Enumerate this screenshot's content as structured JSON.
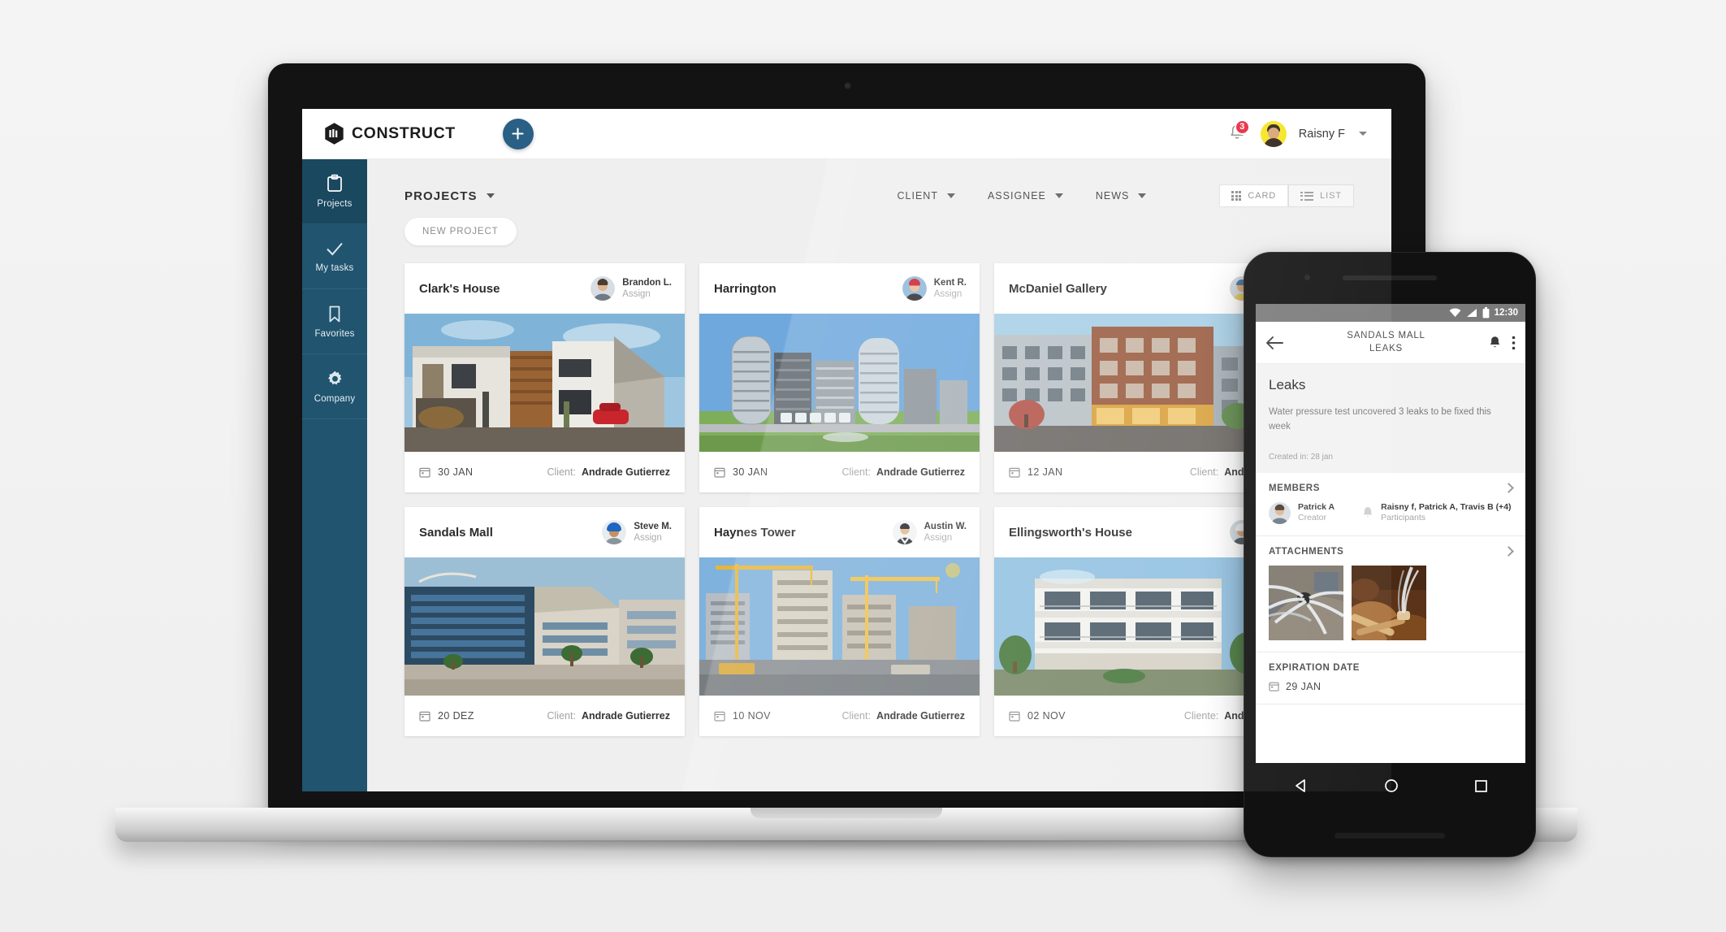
{
  "desktop": {
    "header": {
      "brand_text": "CONSTRUCT",
      "brand_icon": "cube-logo-icon",
      "add_button_icon": "plus-icon",
      "notification_count": "3",
      "notification_icon": "bell-icon",
      "user_name": "Raisny F",
      "user_caret_icon": "chevron-down-icon"
    },
    "sidebar": {
      "items": [
        {
          "label": "Projects",
          "icon": "clipboard-icon",
          "active": true
        },
        {
          "label": "My tasks",
          "icon": "check-icon",
          "active": false
        },
        {
          "label": "Favorites",
          "icon": "bookmark-icon",
          "active": false
        },
        {
          "label": "Company",
          "icon": "gear-icon",
          "active": false
        }
      ]
    },
    "toolbar": {
      "page_title": "PROJECTS",
      "page_title_caret_icon": "chevron-down-icon",
      "filters": [
        {
          "label": "CLIENT",
          "icon": "chevron-down-icon"
        },
        {
          "label": "ASSIGNEE",
          "icon": "chevron-down-icon"
        },
        {
          "label": "NEWS",
          "icon": "chevron-down-icon"
        }
      ],
      "view_modes": [
        {
          "label": "CARD",
          "icon": "grid-icon",
          "active": true
        },
        {
          "label": "LIST",
          "icon": "list-icon",
          "active": false
        }
      ],
      "new_project_label": "NEW PROJECT"
    },
    "cards": [
      {
        "title": "Clark's House",
        "assignee_name": "Brandon L.",
        "assignee_action": "Assign",
        "date": "30  JAN",
        "client_label": "Client:",
        "client_value": "Andrade Gutierrez",
        "image_alt": "modern-two-story-house-with-wood-facade"
      },
      {
        "title": "Harrington",
        "assignee_name": "Kent R.",
        "assignee_action": "Assign",
        "date": "30  JAN",
        "client_label": "Client:",
        "client_value": "Andrade Gutierrez",
        "image_alt": "residential-high-rise-towers"
      },
      {
        "title": "McDaniel Gallery",
        "assignee_name": "",
        "assignee_action": "",
        "date": "12  JAN",
        "client_label": "Client:",
        "client_value": "Andrad",
        "image_alt": "mixed-use-brick-apartment-building"
      },
      {
        "title": "Sandals Mall",
        "assignee_name": "Steve M.",
        "assignee_action": "Assign",
        "date": "20  DEZ",
        "client_label": "Client:",
        "client_value": "Andrade Gutierrez",
        "image_alt": "glass-shopping-mall-exterior"
      },
      {
        "title": "Haynes Tower",
        "assignee_name": "Austin W.",
        "assignee_action": "Assign",
        "date": "10  NOV",
        "client_label": "Client:",
        "client_value": "Andrade Gutierrez",
        "image_alt": "skyscraper-under-construction-with-cranes"
      },
      {
        "title": "Ellingsworth's House",
        "assignee_name": "",
        "assignee_action": "",
        "date": "02  NOV",
        "client_label": "Cliente:",
        "client_value": "Andrad",
        "image_alt": "white-modern-villa-with-balconies"
      }
    ]
  },
  "phone": {
    "status_bar": {
      "time": "12:30",
      "wifi_icon": "wifi-icon",
      "signal_icon": "signal-icon",
      "battery_icon": "battery-icon"
    },
    "appbar": {
      "back_icon": "arrow-left-icon",
      "title_line1": "SANDALS MALL",
      "title_line2": "LEAKS",
      "bell_icon": "bell-icon",
      "overflow_icon": "more-vertical-icon"
    },
    "task": {
      "title": "Leaks",
      "description": "Water pressure test uncovered 3 leaks to be fixed this week",
      "created": "Created in: 28 jan"
    },
    "members": {
      "section_title": "MEMBERS",
      "chevron_icon": "chevron-right-icon",
      "creator_name": "Patrick A",
      "creator_role": "Creator",
      "bell_icon": "bell-icon",
      "participants_names": "Raisny f, Patrick A, Travis B (+4)",
      "participants_label": "Participants"
    },
    "attachments": {
      "section_title": "ATTACHMENTS",
      "chevron_icon": "chevron-right-icon",
      "items": [
        {
          "alt": "broken-pipe-spraying-water"
        },
        {
          "alt": "leaking-pipe-in-trench"
        }
      ]
    },
    "expiration": {
      "section_title": "EXPIRATION DATE",
      "calendar_icon": "calendar-icon",
      "value": "29  JAN"
    },
    "nav_bar": {
      "back_icon": "triangle-back-icon",
      "home_icon": "circle-home-icon",
      "recents_icon": "square-recents-icon"
    }
  },
  "colors": {
    "sidebar": "#20546f",
    "sidebar_active": "#1a485f",
    "accent": "#2a5f86",
    "badge_red": "#e8243a",
    "avatar_yellow": "#f6e31c",
    "page_bg": "#efefef"
  }
}
